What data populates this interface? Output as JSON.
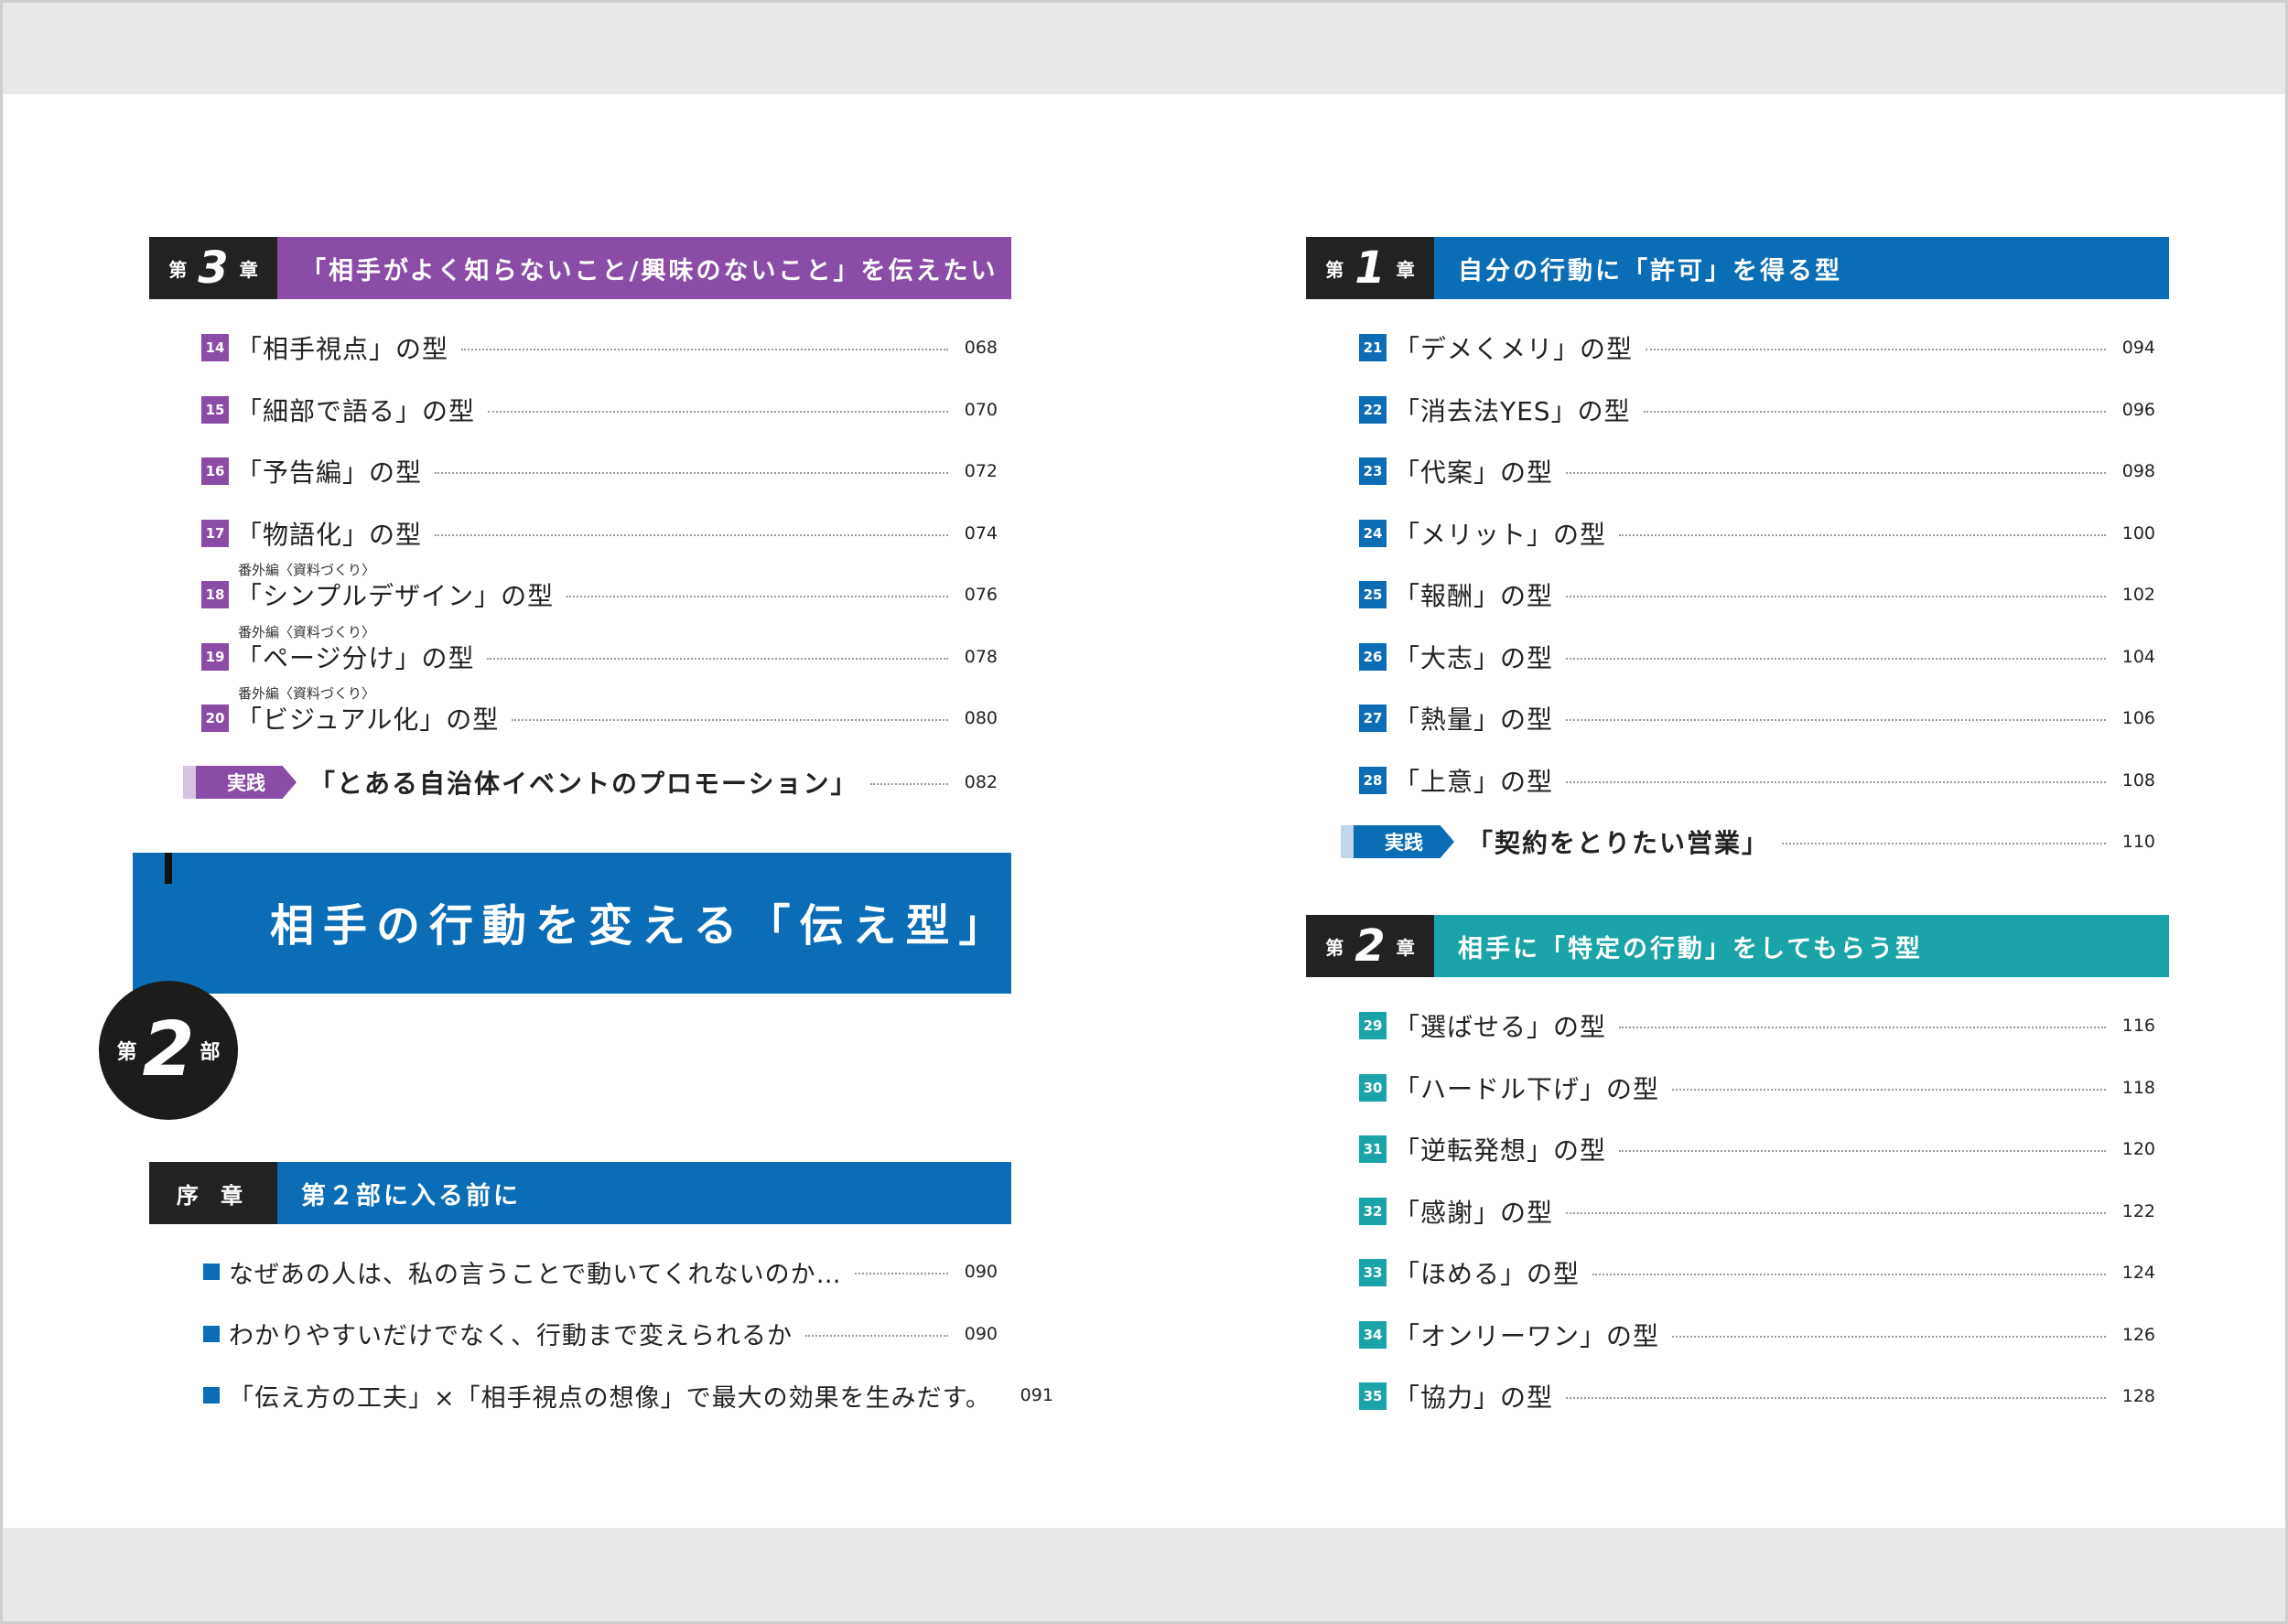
{
  "colors": {
    "purple": "#8a4ca6",
    "blue": "#0a6db5",
    "teal": "#1aa3a8",
    "dark": "#222222"
  },
  "left": {
    "chapter3": {
      "label_prefix": "第",
      "label_num": "3",
      "label_suffix": "章",
      "title": "「相手がよく知らないこと/興味のないこと」を伝えたい",
      "items": [
        {
          "num": "14",
          "title": "「相手視点」の型",
          "page": "068",
          "note": ""
        },
        {
          "num": "15",
          "title": "「細部で語る」の型",
          "page": "070",
          "note": ""
        },
        {
          "num": "16",
          "title": "「予告編」の型",
          "page": "072",
          "note": ""
        },
        {
          "num": "17",
          "title": "「物語化」の型",
          "page": "074",
          "note": ""
        },
        {
          "num": "18",
          "title": "「シンプルデザイン」の型",
          "page": "076",
          "note": "番外編〈資料づくり〉"
        },
        {
          "num": "19",
          "title": "「ページ分け」の型",
          "page": "078",
          "note": "番外編〈資料づくり〉"
        },
        {
          "num": "20",
          "title": "「ビジュアル化」の型",
          "page": "080",
          "note": "番外編〈資料づくり〉"
        }
      ],
      "jissen": {
        "tag": "実践",
        "title": "「とある自治体イベントのプロモーション」",
        "page": "082"
      }
    },
    "part2": {
      "label_prefix": "第",
      "label_num": "2",
      "label_suffix": "部",
      "title": "相手の行動を変える「伝え型」"
    },
    "prologue": {
      "label": "序 章",
      "title": "第２部に入る前に",
      "items": [
        {
          "title": "なぜあの人は、私の言うことで動いてくれないのか…",
          "page": "090"
        },
        {
          "title": "わかりやすいだけでなく、行動まで変えられるか",
          "page": "090"
        },
        {
          "title": "「伝え方の工夫」×「相手視点の想像」で最大の効果を生みだす。",
          "page": "091"
        }
      ]
    }
  },
  "right": {
    "chapter1": {
      "label_prefix": "第",
      "label_num": "1",
      "label_suffix": "章",
      "title": "自分の行動に「許可」を得る型",
      "items": [
        {
          "num": "21",
          "title": "「デメくメリ」の型",
          "page": "094"
        },
        {
          "num": "22",
          "title": "「消去法YES」の型",
          "page": "096"
        },
        {
          "num": "23",
          "title": "「代案」の型",
          "page": "098"
        },
        {
          "num": "24",
          "title": "「メリット」の型",
          "page": "100"
        },
        {
          "num": "25",
          "title": "「報酬」の型",
          "page": "102"
        },
        {
          "num": "26",
          "title": "「大志」の型",
          "page": "104"
        },
        {
          "num": "27",
          "title": "「熱量」の型",
          "page": "106"
        },
        {
          "num": "28",
          "title": "「上意」の型",
          "page": "108"
        }
      ],
      "jissen": {
        "tag": "実践",
        "title": "「契約をとりたい営業」",
        "page": "110"
      }
    },
    "chapter2": {
      "label_prefix": "第",
      "label_num": "2",
      "label_suffix": "章",
      "title": "相手に「特定の行動」をしてもらう型",
      "items": [
        {
          "num": "29",
          "title": "「選ばせる」の型",
          "page": "116"
        },
        {
          "num": "30",
          "title": "「ハードル下げ」の型",
          "page": "118"
        },
        {
          "num": "31",
          "title": "「逆転発想」の型",
          "page": "120"
        },
        {
          "num": "32",
          "title": "「感謝」の型",
          "page": "122"
        },
        {
          "num": "33",
          "title": "「ほめる」の型",
          "page": "124"
        },
        {
          "num": "34",
          "title": "「オンリーワン」の型",
          "page": "126"
        },
        {
          "num": "35",
          "title": "「協力」の型",
          "page": "128"
        }
      ]
    }
  }
}
